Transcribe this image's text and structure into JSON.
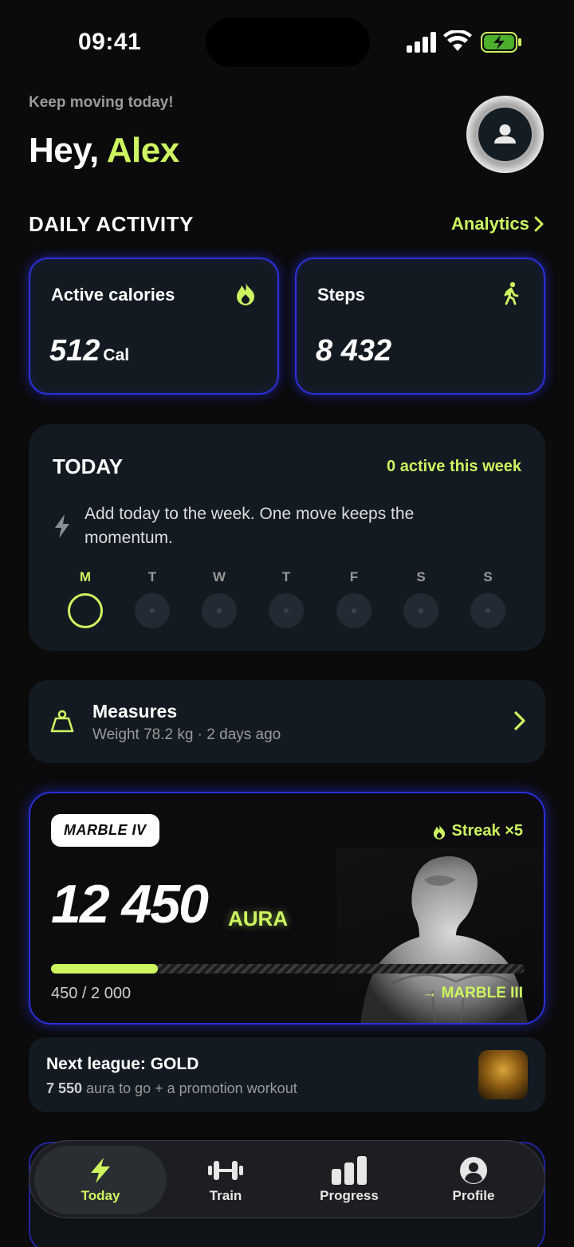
{
  "status_bar": {
    "time": "09:41"
  },
  "header": {
    "subtitle": "Keep moving today!",
    "greeting": "Hey,",
    "name": "Alex"
  },
  "daily_activity": {
    "title": "DAILY ACTIVITY",
    "analytics_link": "Analytics",
    "calories": {
      "label": "Active calories",
      "value": "512",
      "unit": "Cal",
      "icon": "flame-icon"
    },
    "steps": {
      "label": "Steps",
      "value": "8 432",
      "icon": "walking-icon"
    }
  },
  "today_card": {
    "title": "TODAY",
    "week_status": "0 active this week",
    "message": "Add today to the week. One move keeps the momentum.",
    "days": [
      "M",
      "T",
      "W",
      "T",
      "F",
      "S",
      "S"
    ],
    "current_day_index": 0
  },
  "measures": {
    "title": "Measures",
    "subtitle": "Weight 78.2 kg · 2 days ago"
  },
  "aura": {
    "badge": "MARBLE IV",
    "streak": "Streak ×5",
    "value": "12 450",
    "unit": "AURA",
    "progress_current": 450,
    "progress_total": 2000,
    "progress_text": "450 / 2 000",
    "next_rank": "→ MARBLE III"
  },
  "league": {
    "title": "Next league: GOLD",
    "amount": "7 550",
    "subtitle_rest": " aura to go + a promotion workout"
  },
  "tabbar": {
    "today": "Today",
    "train": "Train",
    "progress": "Progress",
    "profile": "Profile"
  },
  "colors": {
    "accent": "#ccf560",
    "glow": "#2b2fd8",
    "card": "#131a22",
    "bg": "#0b0b0c"
  }
}
